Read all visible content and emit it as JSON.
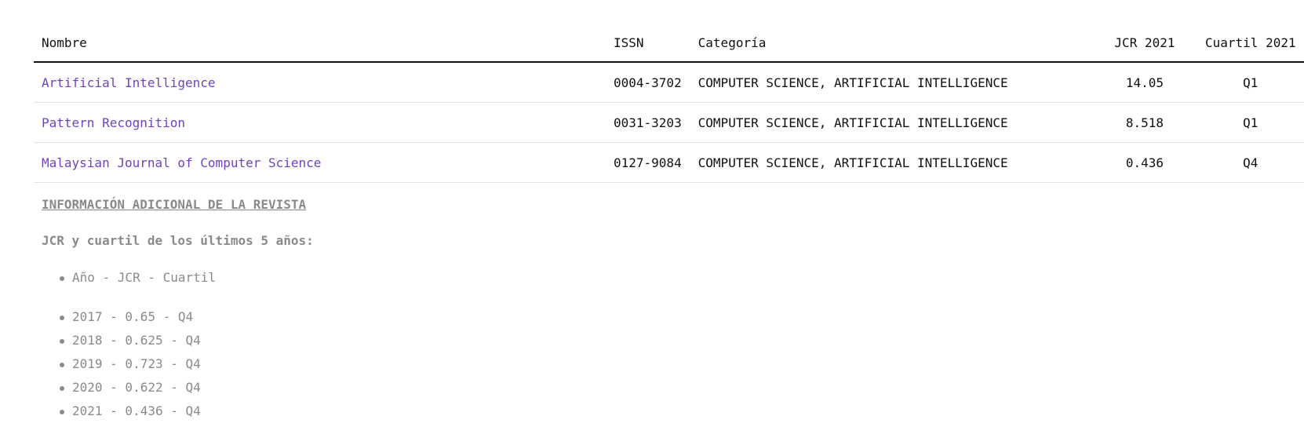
{
  "table": {
    "headers": {
      "name": "Nombre",
      "issn": "ISSN",
      "category": "Categoría",
      "jcr": "JCR 2021",
      "quartile": "Cuartil 2021"
    },
    "rows": [
      {
        "name": "Artificial Intelligence",
        "issn": "0004-3702",
        "category": "COMPUTER SCIENCE, ARTIFICIAL INTELLIGENCE",
        "jcr": "14.05",
        "quartile": "Q1"
      },
      {
        "name": "Pattern Recognition",
        "issn": "0031-3203",
        "category": "COMPUTER SCIENCE, ARTIFICIAL INTELLIGENCE",
        "jcr": "8.518",
        "quartile": "Q1"
      },
      {
        "name": "Malaysian Journal of Computer Science",
        "issn": "0127-9084",
        "category": "COMPUTER SCIENCE, ARTIFICIAL INTELLIGENCE",
        "jcr": "0.436",
        "quartile": "Q4"
      }
    ]
  },
  "additional": {
    "title": "INFORMACIÓN ADICIONAL DE LA REVISTA",
    "subtitle": "JCR y cuartil de los últimos 5 años:",
    "header_item": "Año - JCR - Cuartil",
    "history": [
      "2017 - 0.65 - Q4",
      "2018 - 0.625 - Q4",
      "2019 - 0.723 - Q4",
      "2020 - 0.622 - Q4",
      "2021 - 0.436 - Q4"
    ]
  },
  "colors": {
    "link": "#6f42c1",
    "muted_text": "#8a8a8a",
    "header_rule": "#111111",
    "row_rule": "#e3e3e3"
  }
}
